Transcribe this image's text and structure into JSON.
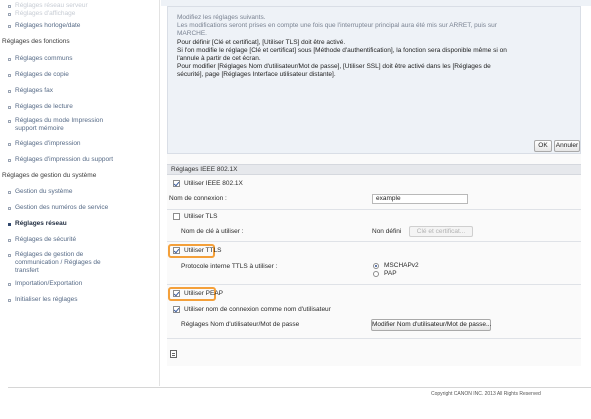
{
  "sidebar": {
    "items": [
      {
        "label": "Réglages réseau serveur",
        "kind": "faded"
      },
      {
        "label": "Réglages d'affichage",
        "kind": "faded"
      },
      {
        "label": "Réglages horloge/date",
        "kind": "item"
      },
      {
        "label": "Réglages des fonctions",
        "kind": "section"
      },
      {
        "label": "Réglages communs",
        "kind": "item"
      },
      {
        "label": "Réglages de copie",
        "kind": "item"
      },
      {
        "label": "Réglages fax",
        "kind": "item"
      },
      {
        "label": "Réglages de lecture",
        "kind": "item"
      },
      {
        "label": "Réglages du mode Impression\nsupport mémoire",
        "kind": "item"
      },
      {
        "label": "Réglages d'impression",
        "kind": "item"
      },
      {
        "label": "Réglages d'impression du support",
        "kind": "item"
      },
      {
        "label": "Réglages de gestion du système",
        "kind": "section"
      },
      {
        "label": "Gestion du système",
        "kind": "item"
      },
      {
        "label": "Gestion des numéros de service",
        "kind": "item"
      },
      {
        "label": "Réglages réseau",
        "kind": "active"
      },
      {
        "label": "Réglages de sécurité",
        "kind": "item"
      },
      {
        "label": "Réglages de gestion de\ncommunication / Réglages de\ntransfert",
        "kind": "item"
      },
      {
        "label": "Importation/Exportation",
        "kind": "item"
      },
      {
        "label": "Initialiser les réglages",
        "kind": "item"
      }
    ]
  },
  "notice": {
    "lines": [
      "Modifiez les réglages suivants.",
      "Les modifications seront prises en compte une fois que l'interrupteur principal aura été mis sur ARRET, puis sur",
      "MARCHE.",
      "Pour définir [Clé et certificat], [Utiliser TLS] doit être activé.",
      "Si l'on modifie le réglage [Clé et certificat] sous [Méthode d'authentification], la fonction sera disponible même si on",
      "l'annule à partir de cet écran.",
      "Pour modifier [Réglages Nom d'utilisateur/Mot de passe], [Utiliser SSL] doit être activé dans les [Réglages de",
      "sécurité], page [Réglages Interface utilisateur distante]."
    ],
    "ok_label": "OK",
    "cancel_label": "Annuler"
  },
  "ieee": {
    "section_title": "Réglages IEEE 802.1X",
    "use_ieee_label": "Utiliser IEEE 802.1X",
    "use_ieee_checked": true,
    "login_name_label": "Nom de connexion :",
    "login_name_value": "example",
    "use_tls_label": "Utiliser TLS",
    "use_tls_checked": false,
    "key_label": "Nom de clé à utiliser :",
    "key_value": "Non défini",
    "key_button": "Clé et certificat...",
    "use_ttls_label": "Utiliser TTLS",
    "use_ttls_checked": true,
    "ttls_protocol_label": "Protocole interne TTLS à utiliser :",
    "ttls_options": [
      "MSCHAPv2",
      "PAP"
    ],
    "ttls_selected": "MSCHAPv2",
    "use_peap_label": "Utiliser PEAP",
    "use_peap_checked": true,
    "use_login_as_user_label": "Utiliser nom de connexion comme nom d'utilisateur",
    "use_login_as_user_checked": true,
    "user_pw_label": "Réglages Nom d'utilisateur/Mot de passe",
    "user_pw_button": "Modifier Nom d'utilisateur/Mot de passe..."
  },
  "footer": {
    "copyright": "Copyright CANON INC. 2013 All Rights Reserved"
  },
  "colors": {
    "highlight": "#f4a03a",
    "panel_background": "#eef2f7",
    "sidebar_link": "#566a86"
  }
}
